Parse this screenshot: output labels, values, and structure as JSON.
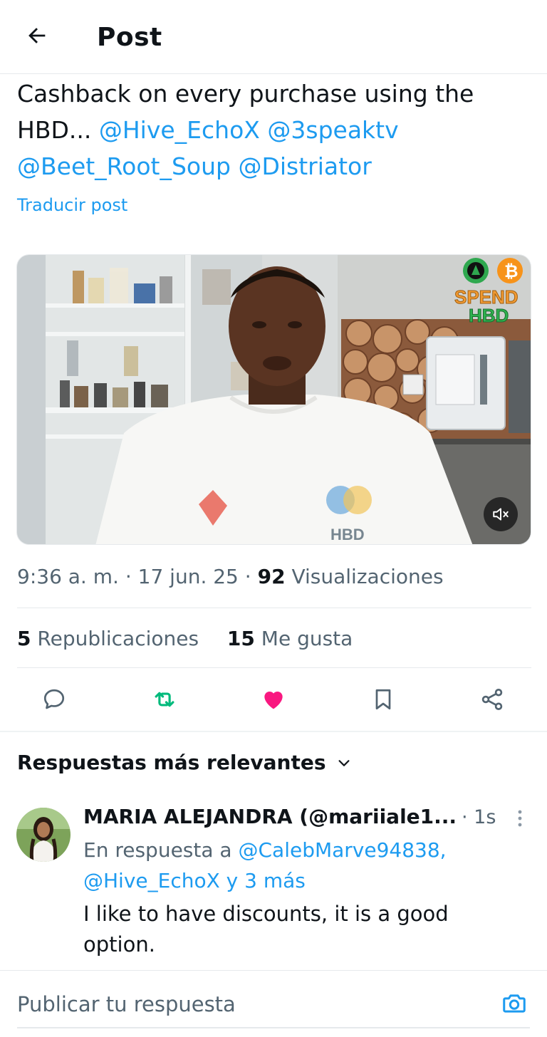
{
  "header": {
    "title": "Post",
    "back_icon": "arrow-left-icon"
  },
  "post": {
    "text_plain": "Cashback on every purchase using the HBD...",
    "mentions": [
      "@Hive_EchoX",
      "@3speaktv",
      "@Beet_Root_Soup",
      "@Distriator"
    ],
    "translate_label": "Traducir post",
    "media": {
      "overlay_logo_text_1": "SPEND",
      "overlay_logo_text_2": "HBD",
      "shirt_text": "HBD",
      "mute_icon": "volume-muted-icon"
    },
    "time": "9:36 a. m.",
    "date": "17 jun. 25",
    "views_count": "92",
    "views_label": "Visualizaciones",
    "reposts_count": "5",
    "reposts_label": "Republicaciones",
    "likes_count": "15",
    "likes_label": "Me gusta"
  },
  "actions": {
    "reply_icon": "reply-bubble-icon",
    "repost_icon": "repost-icon",
    "like_icon": "heart-filled-icon",
    "bookmark_icon": "bookmark-icon",
    "share_icon": "share-icon"
  },
  "replies": {
    "sort_label": "Respuestas más relevantes",
    "items": [
      {
        "name": "MARIA ALEJANDRA (@mariiale1...",
        "time": "· 1s",
        "context_prefix": "En respuesta a",
        "context_mention_1": "@CalebMarve94838,",
        "context_mention_2": "@Hive_EchoX y 3 más",
        "text": "I like to have discounts, it is a good option."
      }
    ]
  },
  "compose": {
    "placeholder": "Publicar tu respuesta",
    "camera_icon": "camera-icon"
  },
  "colors": {
    "accent": "#1d9bf0",
    "like": "#f91880",
    "repost": "#00ba7c",
    "muted_text": "#536471",
    "text": "#0f1419"
  }
}
